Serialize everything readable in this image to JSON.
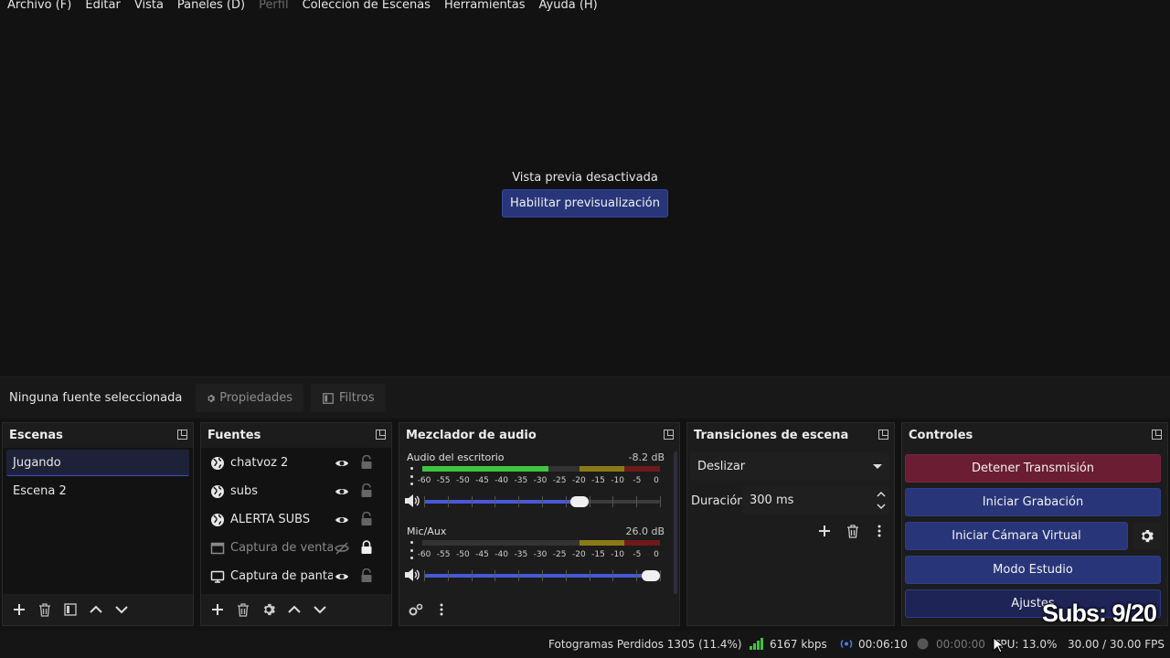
{
  "menu": {
    "items": [
      {
        "label": "Archivo (F)",
        "disabled": false
      },
      {
        "label": "Editar",
        "disabled": false
      },
      {
        "label": "Vista",
        "disabled": false
      },
      {
        "label": "Paneles (D)",
        "disabled": false
      },
      {
        "label": "Perfil",
        "disabled": true
      },
      {
        "label": "Colección de Escenas",
        "disabled": false
      },
      {
        "label": "Herramientas",
        "disabled": false
      },
      {
        "label": "Ayuda (H)",
        "disabled": false
      }
    ]
  },
  "preview": {
    "message": "Vista previa desactivada",
    "enable_button": "Habilitar previsualización"
  },
  "context_bar": {
    "selection_label": "Ninguna fuente seleccionada",
    "properties_label": "Propiedades",
    "filters_label": "Filtros"
  },
  "scenes": {
    "title": "Escenas",
    "items": [
      {
        "label": "Jugando",
        "selected": true
      },
      {
        "label": "Escena 2",
        "selected": false
      }
    ]
  },
  "sources": {
    "title": "Fuentes",
    "items": [
      {
        "label": "chatvoz 2",
        "icon": "globe-icon",
        "visible": true,
        "locked": false
      },
      {
        "label": "subs",
        "icon": "globe-icon",
        "visible": true,
        "locked": false
      },
      {
        "label": "ALERTA SUBS",
        "icon": "globe-icon",
        "visible": true,
        "locked": false
      },
      {
        "label": "Captura de ventana",
        "icon": "window-icon",
        "visible": false,
        "locked": true
      },
      {
        "label": "Captura de pantalla",
        "icon": "monitor-icon",
        "visible": true,
        "locked": false
      }
    ]
  },
  "mixer": {
    "title": "Mezclador de audio",
    "ticks": [
      "-60",
      "-55",
      "-50",
      "-45",
      "-40",
      "-35",
      "-30",
      "-25",
      "-20",
      "-15",
      "-10",
      "-5",
      "0"
    ],
    "channels": [
      {
        "name": "Audio del escritorio",
        "db": "-8.2 dB",
        "level": 0.53,
        "volume": 0.66
      },
      {
        "name": "Mic/Aux",
        "db": "26.0 dB",
        "level": 0.0,
        "volume": 0.96
      }
    ]
  },
  "transitions": {
    "title": "Transiciones de escena",
    "selected": "Deslizar",
    "duration_label": "Duración",
    "duration_value": "300 ms"
  },
  "controls": {
    "title": "Controles",
    "stop_stream": "Detener Transmisión",
    "start_recording": "Iniciar Grabación",
    "start_virtual_cam": "Iniciar Cámara Virtual",
    "studio_mode": "Modo Estudio",
    "settings": "Ajustes"
  },
  "status": {
    "dropped_frames": "Fotogramas Perdidos 1305 (11.4%)",
    "bitrate": "6167 kbps",
    "stream_time": "00:06:10",
    "record_time": "00:00:00",
    "cpu": "CPU: 13.0%",
    "fps": "30.00 / 30.00 FPS"
  },
  "overlay": {
    "subs": "Subs: 9/20"
  },
  "colors": {
    "accent": "#283679",
    "stop": "#6b1d33",
    "meter_green": "#3fc43f",
    "volume_fill": "#4759d8"
  }
}
